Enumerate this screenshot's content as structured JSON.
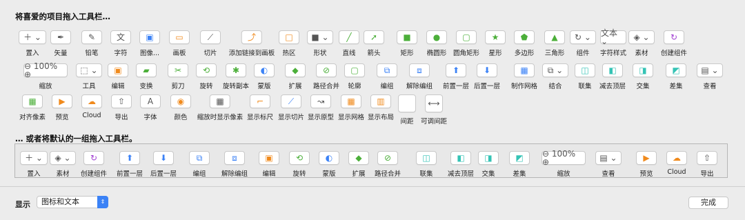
{
  "header": {
    "title": "将喜爱的项目拖入工具栏…"
  },
  "row1": [
    {
      "icon": "plus-icon",
      "glyph": "＋ ⌄",
      "label": "置入"
    },
    {
      "icon": "pen-icon",
      "glyph": "✒",
      "label": "矢量"
    },
    {
      "icon": "pencil-icon",
      "glyph": "✎",
      "label": "铅笔"
    },
    {
      "icon": "text-icon",
      "glyph": "文",
      "label": "字符"
    },
    {
      "icon": "image-icon",
      "glyph": "▣",
      "label": "图像..."
    },
    {
      "icon": "artboard-icon",
      "glyph": "▭",
      "label": "画板"
    },
    {
      "icon": "knife-icon",
      "glyph": "⟋",
      "label": "切片"
    },
    {
      "icon": "link-icon",
      "glyph": "⤴",
      "label": "添加链接到画板"
    },
    {
      "icon": "hotspot-icon",
      "glyph": "□",
      "label": "热区"
    },
    {
      "icon": "shape-icon",
      "glyph": "■ ⌄",
      "label": "形状"
    },
    {
      "icon": "line-icon",
      "glyph": "╱",
      "label": "直线"
    },
    {
      "icon": "arrow-icon",
      "glyph": "➚",
      "label": "箭头"
    },
    {
      "icon": "rectangle-icon",
      "glyph": "■",
      "label": "矩形"
    },
    {
      "icon": "oval-icon",
      "glyph": "●",
      "label": "椭圆形"
    },
    {
      "icon": "rounded-rect-icon",
      "glyph": "▢",
      "label": "圆角矩形"
    },
    {
      "icon": "star-icon",
      "glyph": "★",
      "label": "星形"
    },
    {
      "icon": "polygon-icon",
      "glyph": "⬟",
      "label": "多边形"
    },
    {
      "icon": "triangle-icon",
      "glyph": "▲",
      "label": "三角形"
    },
    {
      "icon": "component-icon",
      "glyph": "↻ ⌄",
      "label": "组件"
    },
    {
      "icon": "text-style-icon",
      "glyph": "文本 ⌄",
      "label": "字符样式"
    },
    {
      "icon": "layers-icon",
      "glyph": "◈ ⌄",
      "label": "素材"
    },
    {
      "icon": "create-component-icon",
      "glyph": "↻",
      "label": "创建组件"
    }
  ],
  "row2": [
    {
      "icon": "zoom-icon",
      "glyph": "⊖ 100% ⊕",
      "label": "缩放"
    },
    {
      "icon": "tools-icon",
      "glyph": "⬚ ⌄",
      "label": "工具"
    },
    {
      "icon": "edit-icon",
      "glyph": "▣",
      "label": "编辑"
    },
    {
      "icon": "transform-icon",
      "glyph": "▰",
      "label": "变换"
    },
    {
      "icon": "scissors-icon",
      "glyph": "✂",
      "label": "剪刀"
    },
    {
      "icon": "rotate-icon",
      "glyph": "⟲",
      "label": "旋转"
    },
    {
      "icon": "rotate-copy-icon",
      "glyph": "✱",
      "label": "旋转副本"
    },
    {
      "icon": "mask-icon",
      "glyph": "◐",
      "label": "蒙版"
    },
    {
      "icon": "flatten-icon",
      "glyph": "◆",
      "label": "扩展"
    },
    {
      "icon": "path-merge-icon",
      "glyph": "⊘",
      "label": "路径合并"
    },
    {
      "icon": "outline-icon",
      "glyph": "▢",
      "label": "轮廓"
    },
    {
      "icon": "group-icon",
      "glyph": "⧉",
      "label": "编组"
    },
    {
      "icon": "ungroup-icon",
      "glyph": "⧈",
      "label": "解除编组"
    },
    {
      "icon": "bring-forward-icon",
      "glyph": "⬆",
      "label": "前置一层"
    },
    {
      "icon": "send-backward-icon",
      "glyph": "⬇",
      "label": "后置一层"
    },
    {
      "icon": "grid-icon",
      "glyph": "▦",
      "label": "制作网格"
    },
    {
      "icon": "combine-icon",
      "glyph": "⧉ ⌄",
      "label": "结合"
    },
    {
      "icon": "union-icon",
      "glyph": "◫",
      "label": "联集"
    },
    {
      "icon": "subtract-icon",
      "glyph": "◧",
      "label": "减去顶层"
    },
    {
      "icon": "intersect-icon",
      "glyph": "◨",
      "label": "交集"
    },
    {
      "icon": "difference-icon",
      "glyph": "◩",
      "label": "差集"
    },
    {
      "icon": "view-icon",
      "glyph": "▤ ⌄",
      "label": "查看"
    }
  ],
  "row3": [
    {
      "icon": "align-pixel-icon",
      "glyph": "▦",
      "label": "对齐像素"
    },
    {
      "icon": "preview-icon",
      "glyph": "▶",
      "label": "预览"
    },
    {
      "icon": "cloud-icon",
      "glyph": "☁",
      "label": "Cloud"
    },
    {
      "icon": "export-icon",
      "glyph": "⇧",
      "label": "导出"
    },
    {
      "icon": "font-icon",
      "glyph": "A",
      "label": "字体"
    },
    {
      "icon": "color-icon",
      "glyph": "◉",
      "label": "颜色"
    },
    {
      "icon": "pixel-zoom-icon",
      "glyph": "▦",
      "label": "缩放时显示像素"
    },
    {
      "icon": "rulers-icon",
      "glyph": "⌐",
      "label": "显示标尺"
    },
    {
      "icon": "show-slices-icon",
      "glyph": "⟋",
      "label": "显示切片"
    },
    {
      "icon": "prototype-icon",
      "glyph": "↝",
      "label": "显示原型"
    },
    {
      "icon": "show-grid-icon",
      "glyph": "▦",
      "label": "显示网格"
    },
    {
      "icon": "show-layout-icon",
      "glyph": "▥",
      "label": "显示布局"
    },
    {
      "icon": "spacing-icon",
      "glyph": "",
      "label": "间距"
    },
    {
      "icon": "flexible-spacing-icon",
      "glyph": "⟷",
      "label": "可调间距"
    }
  ],
  "default_header": {
    "title": "… 或者将默认的一组拖入工具栏。"
  },
  "default_row": [
    {
      "icon": "plus-icon",
      "glyph": "＋ ⌄",
      "label": "置入"
    },
    {
      "icon": "layers-icon",
      "glyph": "◈ ⌄",
      "label": "素材"
    },
    {
      "icon": "create-component-icon",
      "glyph": "↻",
      "label": "创建组件"
    },
    {
      "icon": "bring-forward-icon",
      "glyph": "⬆",
      "label": "前置一层"
    },
    {
      "icon": "send-backward-icon",
      "glyph": "⬇",
      "label": "后置一层"
    },
    {
      "icon": "group-icon",
      "glyph": "⧉",
      "label": "编组"
    },
    {
      "icon": "ungroup-icon",
      "glyph": "⧈",
      "label": "解除编组"
    },
    {
      "icon": "edit-icon",
      "glyph": "▣",
      "label": "编辑"
    },
    {
      "icon": "rotate-icon",
      "glyph": "⟲",
      "label": "旋转"
    },
    {
      "icon": "mask-icon",
      "glyph": "◐",
      "label": "蒙版"
    },
    {
      "icon": "flatten-icon",
      "glyph": "◆",
      "label": "扩展"
    },
    {
      "icon": "path-merge-icon",
      "glyph": "⊘",
      "label": "路径合并"
    },
    {
      "icon": "union-icon",
      "glyph": "◫",
      "label": "联集"
    },
    {
      "icon": "subtract-icon",
      "glyph": "◧",
      "label": "减去顶层"
    },
    {
      "icon": "intersect-icon",
      "glyph": "◨",
      "label": "交集"
    },
    {
      "icon": "difference-icon",
      "glyph": "◩",
      "label": "差集"
    },
    {
      "icon": "zoom-icon",
      "glyph": "⊖ 100% ⊕",
      "label": "缩放"
    },
    {
      "icon": "view-icon",
      "glyph": "▤ ⌄",
      "label": "查看"
    },
    {
      "icon": "preview-icon",
      "glyph": "▶",
      "label": "预览"
    },
    {
      "icon": "cloud-icon",
      "glyph": "☁",
      "label": "Cloud"
    },
    {
      "icon": "export-icon",
      "glyph": "⇧",
      "label": "导出"
    }
  ],
  "footer": {
    "show_label": "显示",
    "show_value": "图标和文本",
    "done_label": "完成"
  },
  "colors": {
    "green": "#4caf3a",
    "orange": "#f08a1c",
    "purple": "#a03dd1",
    "blue": "#3b82f6",
    "teal": "#35c3b5"
  }
}
